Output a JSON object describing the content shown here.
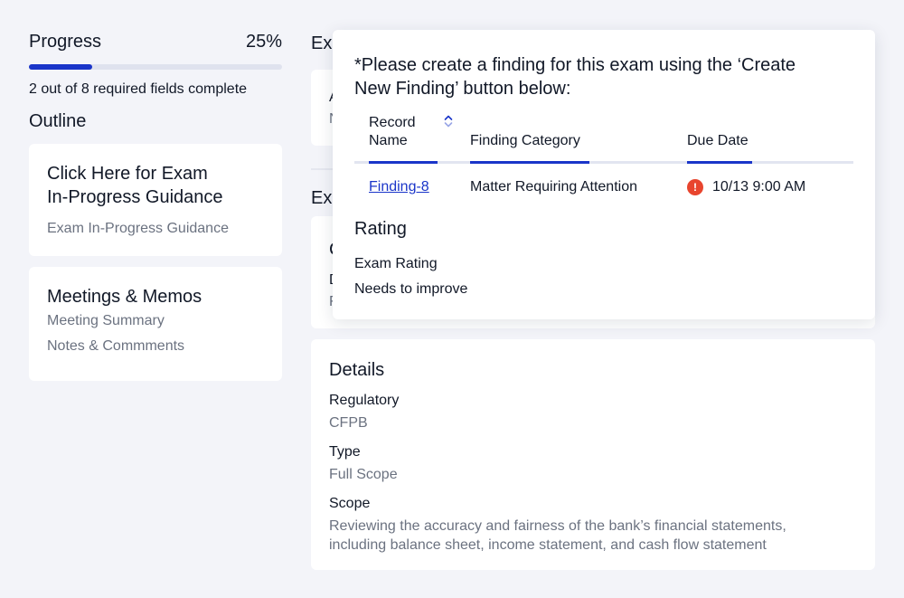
{
  "progress": {
    "label": "Progress",
    "percent_text": "25%",
    "percent": 25,
    "summary": "2 out of 8 required fields complete"
  },
  "outline": {
    "title": "Outline",
    "cards": [
      {
        "title_line1": "Click Here for Exam",
        "title_line2": "In-Progress Guidance",
        "links": [
          "Exam In-Progress Guidance"
        ]
      },
      {
        "title_line1": "Meetings & Memos",
        "links": [
          "Meeting Summary",
          "Notes & Commments"
        ]
      }
    ]
  },
  "background": {
    "heading1": "Ex",
    "heading2": "Ex",
    "letter_a": "A",
    "letter_n": "N",
    "letter_c": "C",
    "letter_d": "D",
    "letter_f": "F"
  },
  "popup": {
    "message_line1": "*Please create a finding for this exam using the ‘Create",
    "message_line2": "New Finding’ button below:",
    "columns": {
      "record_name_line1": "Record",
      "record_name_line2": "Name",
      "finding_category": "Finding Category",
      "due_date": "Due Date"
    },
    "row": {
      "record": "Finding-8",
      "category": "Matter Requiring Attention",
      "due": "10/13 9:00 AM",
      "alert_icon": "exclamation-icon"
    },
    "rating": {
      "title": "Rating",
      "label": "Exam Rating",
      "value": "Needs to improve"
    }
  },
  "details": {
    "title": "Details",
    "fields": [
      {
        "label": "Regulatory",
        "value": "CFPB"
      },
      {
        "label": "Type",
        "value": "Full Scope"
      },
      {
        "label": "Scope",
        "value_line1": "Reviewing the accuracy and fairness of the bank’s financial statements,",
        "value_line2": "including balance sheet, income statement, and cash flow statement"
      }
    ]
  },
  "colors": {
    "accent": "#1a35c9",
    "alert": "#e8452e",
    "background": "#f3f4f9",
    "muted_text": "#6b7280"
  }
}
